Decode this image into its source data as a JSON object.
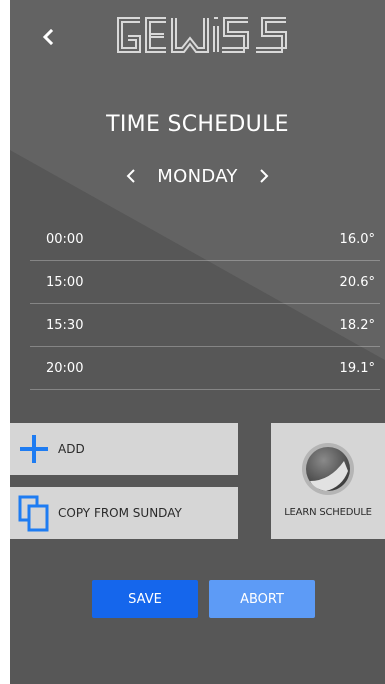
{
  "header": {
    "back_icon": "chevron-left-icon",
    "logo_text": "GEWISS"
  },
  "title": "TIME SCHEDULE",
  "day_selector": {
    "prev_icon": "chevron-left-icon",
    "day": "MONDAY",
    "next_icon": "chevron-right-icon"
  },
  "schedule": [
    {
      "time": "00:00",
      "temp": "16.0°"
    },
    {
      "time": "15:00",
      "temp": "20.6°"
    },
    {
      "time": "15:30",
      "temp": "18.2°"
    },
    {
      "time": "20:00",
      "temp": "19.1°"
    }
  ],
  "actions": {
    "add_label": "ADD",
    "add_icon": "plus-icon",
    "copy_label": "COPY FROM SUNDAY",
    "copy_icon": "copy-icon",
    "learn_label": "LEARN SCHEDULE",
    "learn_icon": "learn-dial-icon"
  },
  "buttons": {
    "save": "SAVE",
    "abort": "ABORT"
  },
  "colors": {
    "background": "#5f5f5f",
    "tile": "#d6d6d6",
    "accent_blue": "#1e7cf2",
    "save": "#1566ec",
    "abort": "#5d9bf6"
  }
}
